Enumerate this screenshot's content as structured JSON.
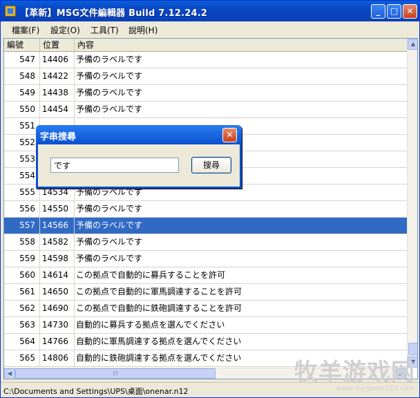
{
  "window": {
    "title": "【革新】MSG文件編輯器 Build 7.12.24.2",
    "minimize": "_",
    "maximize": "□",
    "close": "✕"
  },
  "menu": {
    "items": [
      {
        "label": "檔案(F)"
      },
      {
        "label": "設定(O)"
      },
      {
        "label": "工具(T)"
      },
      {
        "label": "說明(H)"
      }
    ]
  },
  "table": {
    "columns": [
      "編號",
      "位置",
      "內容"
    ],
    "rows": [
      {
        "num": "547",
        "pos": "14406",
        "text": "予備のラベルです"
      },
      {
        "num": "548",
        "pos": "14422",
        "text": "予備のラベルです"
      },
      {
        "num": "549",
        "pos": "14438",
        "text": "予備のラベルです"
      },
      {
        "num": "550",
        "pos": "14454",
        "text": "予備のラベルです"
      },
      {
        "num": "551",
        "pos": "",
        "text": ""
      },
      {
        "num": "552",
        "pos": "",
        "text": ""
      },
      {
        "num": "553",
        "pos": "",
        "text": ""
      },
      {
        "num": "554",
        "pos": "",
        "text": ""
      },
      {
        "num": "555",
        "pos": "14534",
        "text": "予備のラベルです"
      },
      {
        "num": "556",
        "pos": "14550",
        "text": "予備のラベルです"
      },
      {
        "num": "557",
        "pos": "14566",
        "text": "予備のラベルです"
      },
      {
        "num": "558",
        "pos": "14582",
        "text": "予備のラベルです"
      },
      {
        "num": "559",
        "pos": "14598",
        "text": "予備のラベルです"
      },
      {
        "num": "560",
        "pos": "14614",
        "text": "この拠点で自動的に募兵することを許可"
      },
      {
        "num": "561",
        "pos": "14650",
        "text": "この拠点で自動的に軍馬調達することを許可"
      },
      {
        "num": "562",
        "pos": "14690",
        "text": "この拠点で自動的に鉄砲調達することを許可"
      },
      {
        "num": "563",
        "pos": "14730",
        "text": "自動的に募兵する拠点を選んでください"
      },
      {
        "num": "564",
        "pos": "14766",
        "text": "自動的に軍馬調達する拠点を選んでください"
      },
      {
        "num": "565",
        "pos": "14806",
        "text": "自動的に鉄砲調達する拠点を選んでください"
      }
    ],
    "selected_row": "557"
  },
  "status": {
    "path": "C:\\Documents and Settings\\UPS\\桌面\\onenar.n12"
  },
  "watermark": {
    "main": "牧羊游戏网",
    "url": "www.mygame123.com"
  },
  "search_dialog": {
    "title": "字串搜尋",
    "input_value": "です",
    "button_label": "搜尋",
    "close": "✕"
  },
  "colors": {
    "title_bar": "#0a50d0",
    "selection": "#316ac5",
    "window_bg": "#ece9d8"
  }
}
